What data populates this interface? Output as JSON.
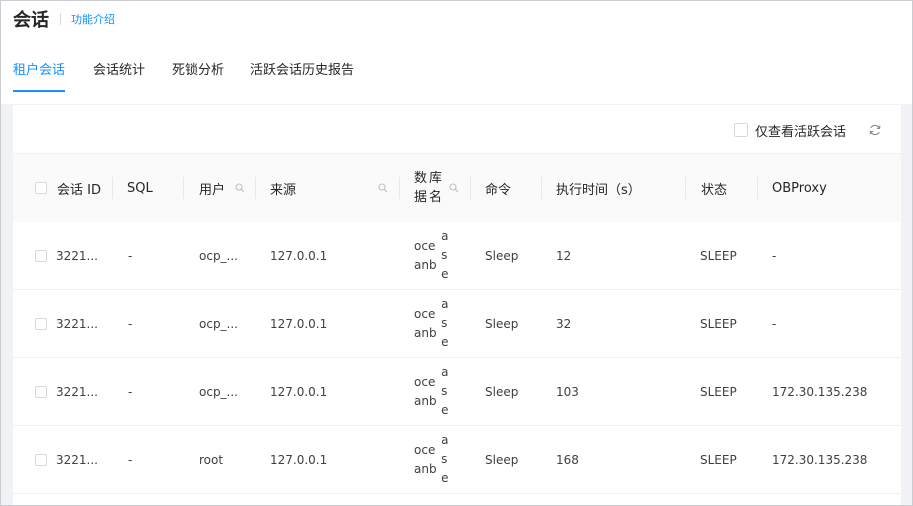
{
  "header": {
    "title": "会话",
    "intro_link": "功能介绍"
  },
  "tabs": [
    {
      "label": "租户会话",
      "active": true
    },
    {
      "label": "会话统计",
      "active": false
    },
    {
      "label": "死锁分析",
      "active": false
    },
    {
      "label": "活跃会话历史报告",
      "active": false
    }
  ],
  "toolbar": {
    "active_only_label": "仅查看活跃会话",
    "active_only_checked": false
  },
  "table": {
    "columns": [
      "会话 ID",
      "SQL",
      "用户",
      "来源",
      "数据库名",
      "命令",
      "执行时间（s）",
      "状态",
      "OBProxy"
    ],
    "column_db_line1": "数据",
    "column_db_line2": "库名",
    "rows": [
      {
        "session_id": "3221...",
        "sql": "-",
        "user": "ocp_...",
        "source": "127.0.0.1",
        "db_line1": "oceanb",
        "db_line2": "ase",
        "command": "Sleep",
        "exec_time": "12",
        "status": "SLEEP",
        "obproxy": "-"
      },
      {
        "session_id": "3221...",
        "sql": "-",
        "user": "ocp_...",
        "source": "127.0.0.1",
        "db_line1": "oceanb",
        "db_line2": "ase",
        "command": "Sleep",
        "exec_time": "32",
        "status": "SLEEP",
        "obproxy": "-"
      },
      {
        "session_id": "3221...",
        "sql": "-",
        "user": "ocp_...",
        "source": "127.0.0.1",
        "db_line1": "oceanb",
        "db_line2": "ase",
        "command": "Sleep",
        "exec_time": "103",
        "status": "SLEEP",
        "obproxy": "172.30.135.238"
      },
      {
        "session_id": "3221...",
        "sql": "-",
        "user": "root",
        "source": "127.0.0.1",
        "db_line1": "oceanb",
        "db_line2": "ase",
        "command": "Sleep",
        "exec_time": "168",
        "status": "SLEEP",
        "obproxy": "172.30.135.238"
      }
    ]
  },
  "colors": {
    "accent": "#1890ff",
    "page_bg": "#f0f2f5",
    "header_bg": "#fafafa"
  },
  "icons": {
    "refresh": "refresh-icon",
    "search": "search-icon"
  }
}
